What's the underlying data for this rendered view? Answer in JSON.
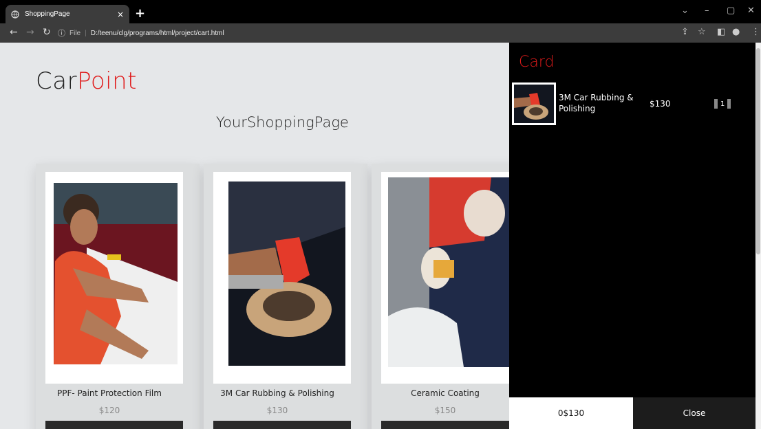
{
  "browser": {
    "tab_title": "ShoppingPage",
    "tab_close": "×",
    "new_tab": "+",
    "file_label": "File",
    "url": "D:/teenu/clg/programs/html/project/cart.html"
  },
  "header": {
    "logo_main": "Car",
    "logo_accent": "Point",
    "shop_title": "YourShoppingPage"
  },
  "products": [
    {
      "name": "PPF- Paint Protection Film",
      "price": "$120"
    },
    {
      "name": "3M Car Rubbing & Polishing",
      "price": "$130"
    },
    {
      "name": "Ceramic Coating",
      "price": "$150"
    }
  ],
  "cart": {
    "title": "Card",
    "items": [
      {
        "name": "3M Car Rubbing & Polishing",
        "price": "$130",
        "qty": "1"
      }
    ],
    "total": "0$130",
    "close_label": "Close"
  },
  "colors": {
    "accent": "#e01b1b",
    "page_bg": "#e5e7e9",
    "cart_bg": "#000000"
  }
}
